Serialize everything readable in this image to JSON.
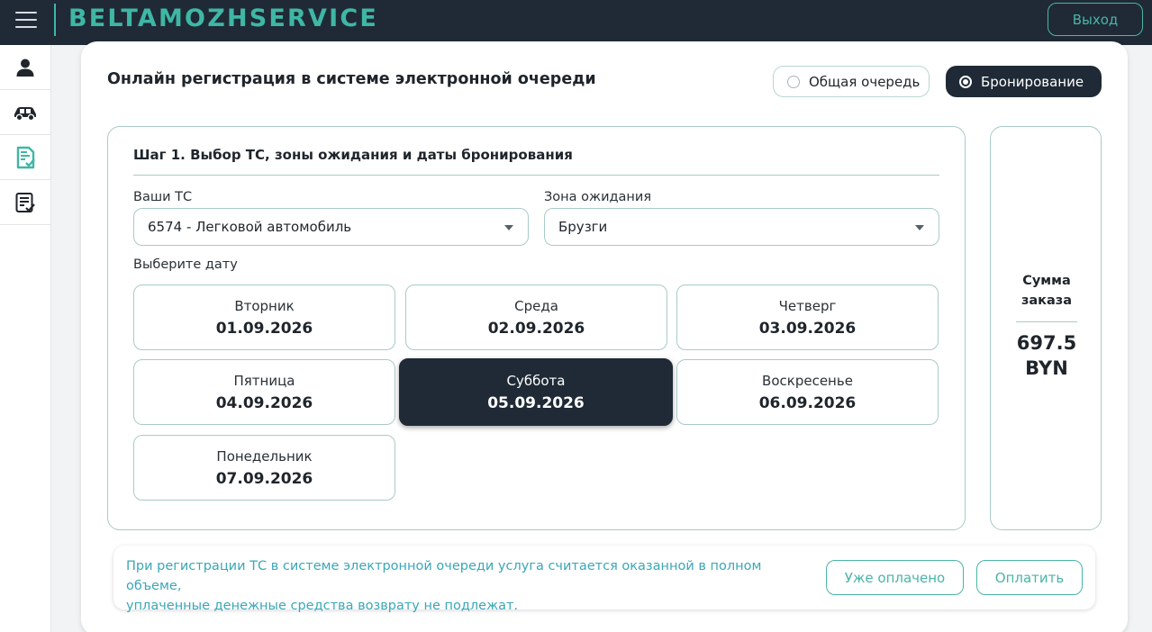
{
  "header": {
    "logo": "BELTAMOZHSERVICE",
    "logout_label": "Выход"
  },
  "sidebar": {
    "items": [
      {
        "icon": "person-icon"
      },
      {
        "icon": "car-icon"
      },
      {
        "icon": "document-icon"
      },
      {
        "icon": "checklist-icon"
      }
    ]
  },
  "page": {
    "title": "Онлайн регистрация в системе электронной очереди",
    "modes": [
      {
        "label": "Общая очередь",
        "selected": false
      },
      {
        "label": "Бронирование",
        "selected": true
      }
    ]
  },
  "step": {
    "title": "Шаг 1. Выбор ТС, зоны ожидания и даты бронирования",
    "vehicle_label": "Ваши ТС",
    "vehicle_value": "6574 - Легковой автомобиль",
    "zone_label": "Зона ожидания",
    "zone_value": "Брузги",
    "date_label": "Выберите дату",
    "dates": [
      {
        "day": "Вторник",
        "date": "01.09.2026",
        "selected": false
      },
      {
        "day": "Среда",
        "date": "02.09.2026",
        "selected": false
      },
      {
        "day": "Четверг",
        "date": "03.09.2026",
        "selected": false
      },
      {
        "day": "Пятница",
        "date": "04.09.2026",
        "selected": false
      },
      {
        "day": "Суббота",
        "date": "05.09.2026",
        "selected": true
      },
      {
        "day": "Воскресенье",
        "date": "06.09.2026",
        "selected": false
      },
      {
        "day": "Понедельник",
        "date": "07.09.2026",
        "selected": false
      }
    ]
  },
  "order": {
    "sum_label_line1": "Сумма",
    "sum_label_line2": "заказа",
    "sum_amount": "697.5",
    "sum_currency": "BYN"
  },
  "notice": {
    "line1": "При регистрации ТС в системе электронной очереди услуга считается оказанной в полном объеме,",
    "line2": "уплаченные денежные средства возврату не подлежат.",
    "paid_label": "Уже оплачено",
    "pay_label": "Оплатить"
  },
  "colors": {
    "header_bg": "#1f2a36",
    "accent": "#3fb7a5",
    "border": "#a9cbc6",
    "notice_text": "#3aa7b7",
    "selected_bg": "#1f2a36"
  }
}
